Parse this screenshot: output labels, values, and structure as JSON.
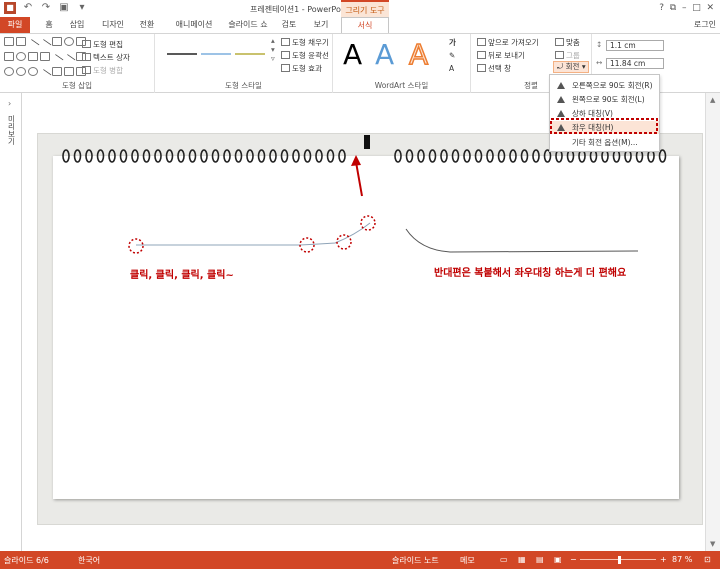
{
  "window": {
    "title": "프레젠테이션1 - PowerPoint",
    "context_tab_group": "그리기 도구",
    "login": "로그인"
  },
  "tabs": [
    "파일",
    "홈",
    "삽입",
    "디자인",
    "전환",
    "애니메이션",
    "슬라이드 쇼",
    "검토",
    "보기",
    "서식"
  ],
  "ribbon": {
    "insert_shapes": {
      "label": "도형 삽입",
      "edit_shape": "도형 편집",
      "text_box": "텍스트 상자",
      "merge_shapes": "도형 병합"
    },
    "shape_styles": {
      "label": "도형 스타일",
      "fill": "도형 채우기",
      "outline": "도형 윤곽선",
      "effects": "도형 효과",
      "line_colors": [
        "#595959",
        "#9dc3e6",
        "#c9c26e"
      ]
    },
    "wordart": {
      "label": "WordArt 스타일",
      "letters": [
        "A",
        "A",
        "A"
      ],
      "letter_colors": [
        "#000000",
        "#5b9bd5",
        "#ed7d31"
      ],
      "text_fill_icon": "가"
    },
    "arrange": {
      "label": "정렬",
      "bring_forward": "앞으로 가져오기",
      "send_backward": "뒤로 보내기",
      "selection_pane": "선택 창",
      "align": "맞춤",
      "group": "그룹",
      "rotate": "회전"
    },
    "size": {
      "height": "1.1 cm",
      "width": "11.84 cm"
    }
  },
  "rotate_menu": {
    "items": [
      {
        "label": "오른쪽으로 90도 회전(R)"
      },
      {
        "label": "왼쪽으로 90도 회전(L)"
      },
      {
        "label": "상하 대칭(V)"
      },
      {
        "label": "좌우 대칭(H)"
      },
      {
        "label": "기타 회전 옵션(M)..."
      }
    ]
  },
  "left_pane": {
    "label": "미리보기"
  },
  "slide": {
    "note_left": "클릭, 클릭, 클릭, 클릭~",
    "note_right": "반대편은 복붙해서 좌우대칭 하는게 더 편해요",
    "annotation_color": "#c00000"
  },
  "status": {
    "slide_number": "슬라이드 6/6",
    "language": "한국어",
    "notes": "슬라이드 노트",
    "comments": "메모",
    "zoom": "87 %"
  },
  "colors": {
    "accent": "#d24726",
    "highlight": "#fce4d6"
  }
}
